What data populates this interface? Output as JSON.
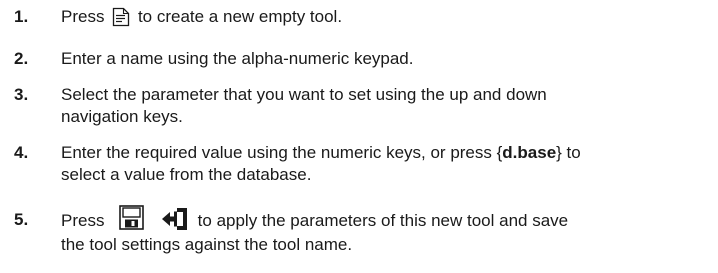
{
  "steps": [
    {
      "number": "1.",
      "before": "Press",
      "icon": "new-tool-icon",
      "after": "to create a new empty tool."
    },
    {
      "number": "2.",
      "line1": "Enter a name using the alpha-numeric keypad."
    },
    {
      "number": "3.",
      "line1": "Select the parameter that you want to set using the up and down",
      "line2": "navigation keys."
    },
    {
      "number": "4.",
      "line1_before": "Enter the required value using the numeric keys, or press {",
      "line1_bold": "d.base",
      "line1_after": "} to",
      "line2": "select a value from the database."
    },
    {
      "number": "5.",
      "before": "Press",
      "icons": [
        "save-icon",
        "apply-icon"
      ],
      "line1_after": "to apply the parameters of this new tool and save",
      "line2": "the tool settings against the tool name."
    }
  ]
}
